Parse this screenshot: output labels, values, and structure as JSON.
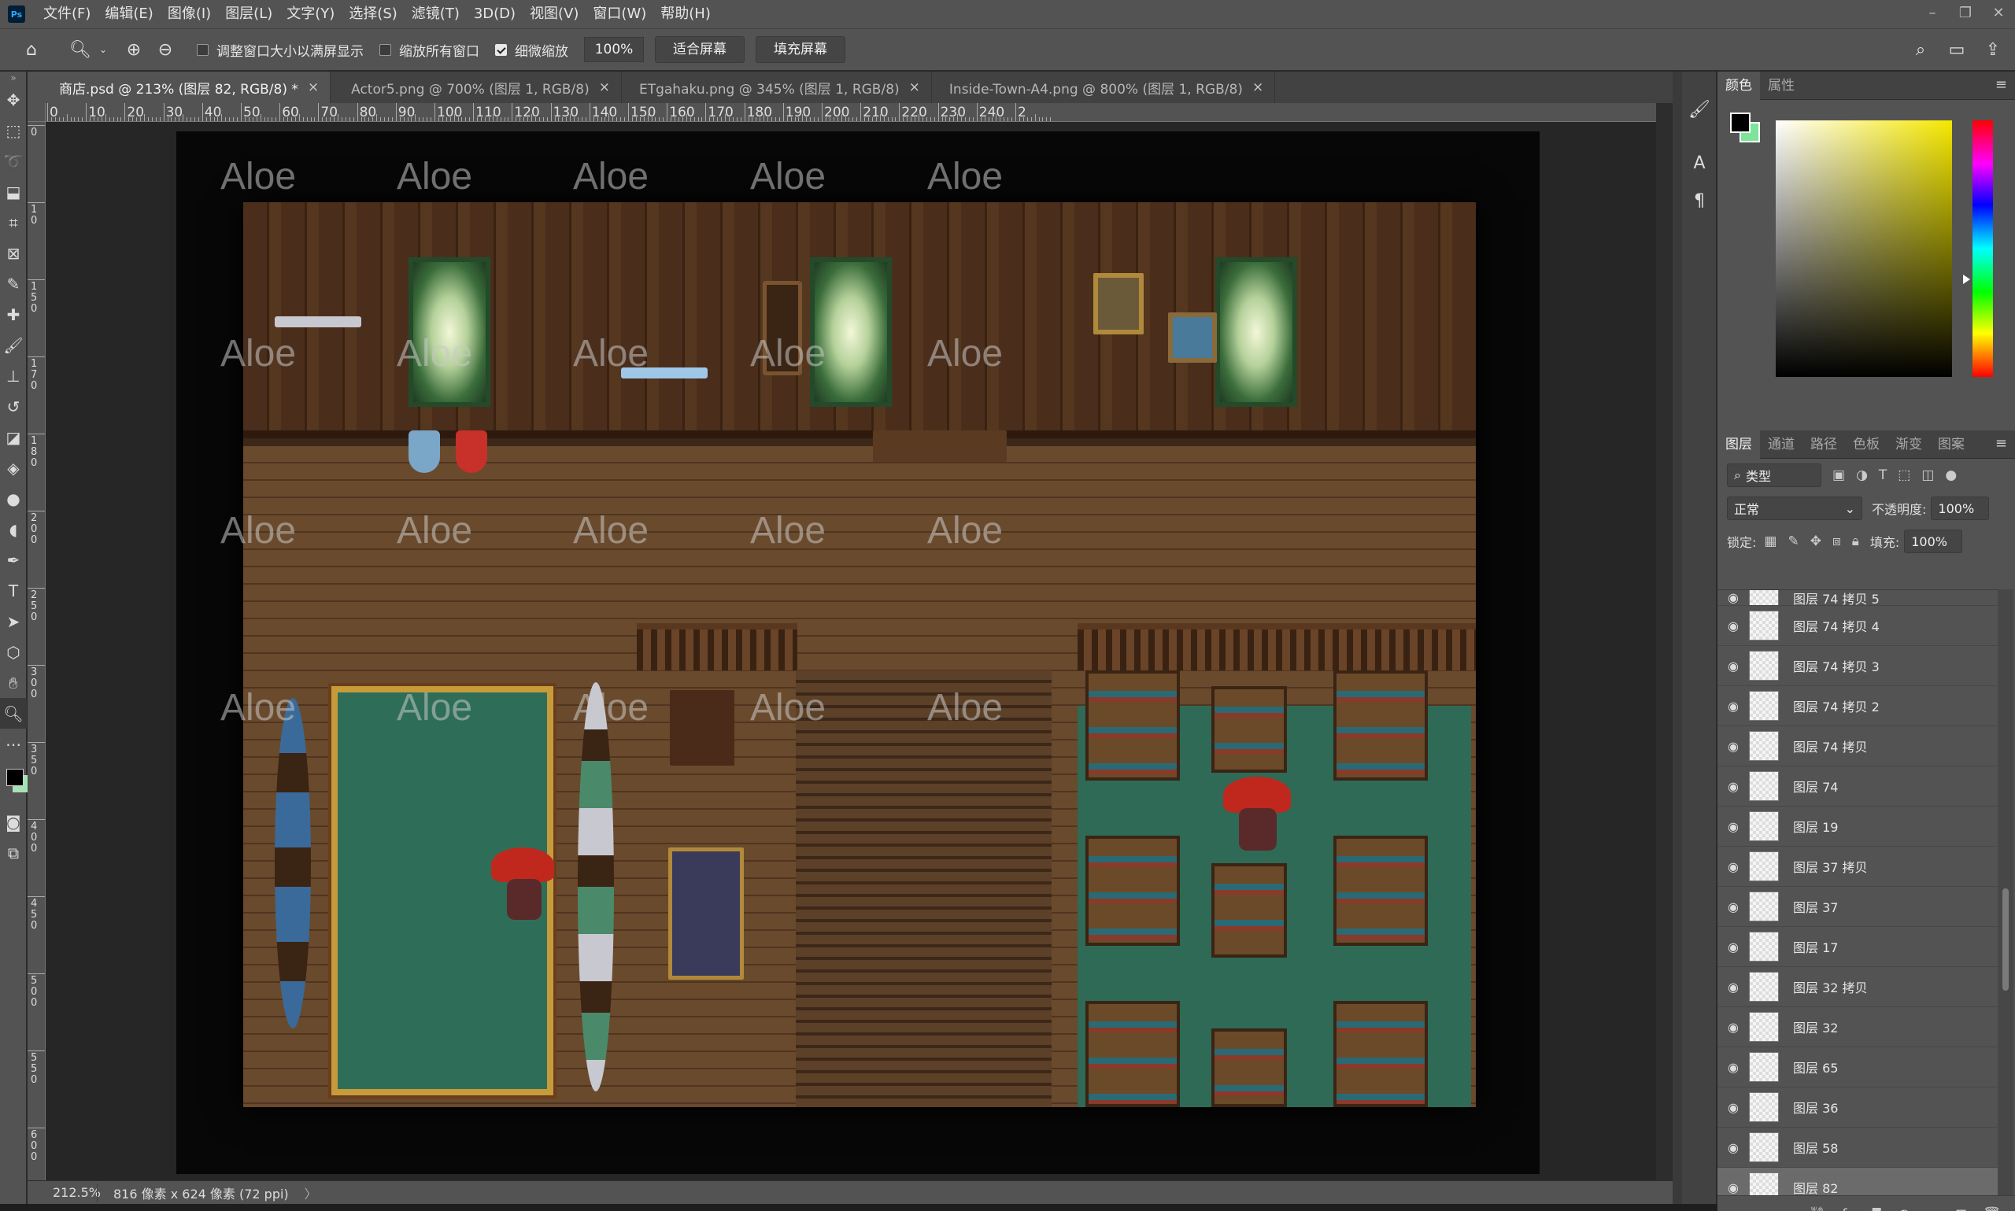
{
  "menubar": {
    "items": [
      "文件(F)",
      "编辑(E)",
      "图像(I)",
      "图层(L)",
      "文字(Y)",
      "选择(S)",
      "滤镜(T)",
      "3D(D)",
      "视图(V)",
      "窗口(W)",
      "帮助(H)"
    ]
  },
  "optionsbar": {
    "resize_windows_label": "调整窗口大小以满屏显示",
    "zoom_all_windows_label": "缩放所有窗口",
    "scrubby_zoom_label": "细微缩放",
    "zoom_value": "100%",
    "fit_screen_label": "适合屏幕",
    "fill_screen_label": "填充屏幕"
  },
  "doctabs": [
    {
      "title": "商店.psd @ 213% (图层 82, RGB/8) *",
      "active": true
    },
    {
      "title": "Actor5.png @ 700% (图层 1, RGB/8)",
      "active": false
    },
    {
      "title": "ETgahaku.png @ 345% (图层 1, RGB/8)",
      "active": false
    },
    {
      "title": "Inside-Town-A4.png @ 800% (图层 1, RGB/8)",
      "active": false
    }
  ],
  "ruler_h_labels": [
    "0",
    "10",
    "20",
    "30",
    "40",
    "50",
    "60",
    "70",
    "80",
    "90",
    "100",
    "110",
    "120",
    "130",
    "140",
    "150",
    "160",
    "170",
    "180",
    "190",
    "200",
    "210",
    "220",
    "230",
    "240",
    "2"
  ],
  "ruler_v_labels": [
    "0",
    "1 0",
    "1 5 0",
    "1 7 0",
    "1 8 0",
    "2 0 0",
    "2 5 0",
    "3 0 0",
    "3 5 0",
    "4 0 0",
    "4 5 0",
    "5 0 0",
    "5 5 0",
    "6 0 0"
  ],
  "canvas": {
    "watermark_text": "Aloe"
  },
  "statusbar": {
    "zoom": "212.5%",
    "doc_size": "816 像素 x 624 像素 (72 ppi)",
    "arrow": "〉"
  },
  "color_panel": {
    "tabs": [
      "颜色",
      "属性"
    ],
    "foreground": "#000000",
    "background": "#7de49a"
  },
  "layers_panel": {
    "tabs": [
      "图层",
      "通道",
      "路径",
      "色板",
      "渐变",
      "图案"
    ],
    "filter_label": "类型",
    "blend_mode": "正常",
    "opacity_label": "不透明度:",
    "opacity_value": "100%",
    "lock_label": "锁定:",
    "fill_label": "填充:",
    "fill_value": "100%",
    "layers": [
      {
        "name": "图层 74 拷贝 5",
        "partial": true
      },
      {
        "name": "图层 74 拷贝 4"
      },
      {
        "name": "图层 74 拷贝 3"
      },
      {
        "name": "图层 74 拷贝 2"
      },
      {
        "name": "图层 74 拷贝"
      },
      {
        "name": "图层 74"
      },
      {
        "name": "图层 19"
      },
      {
        "name": "图层 37 拷贝"
      },
      {
        "name": "图层 37"
      },
      {
        "name": "图层 17"
      },
      {
        "name": "图层 32 拷贝"
      },
      {
        "name": "图层 32"
      },
      {
        "name": "图层 65"
      },
      {
        "name": "图层 36"
      },
      {
        "name": "图层 58"
      },
      {
        "name": "图层 82",
        "selected": true
      }
    ]
  },
  "colors": {
    "ui_bg": "#535353",
    "canvas_bg": "#262626",
    "accent_green": "#7de49a"
  }
}
